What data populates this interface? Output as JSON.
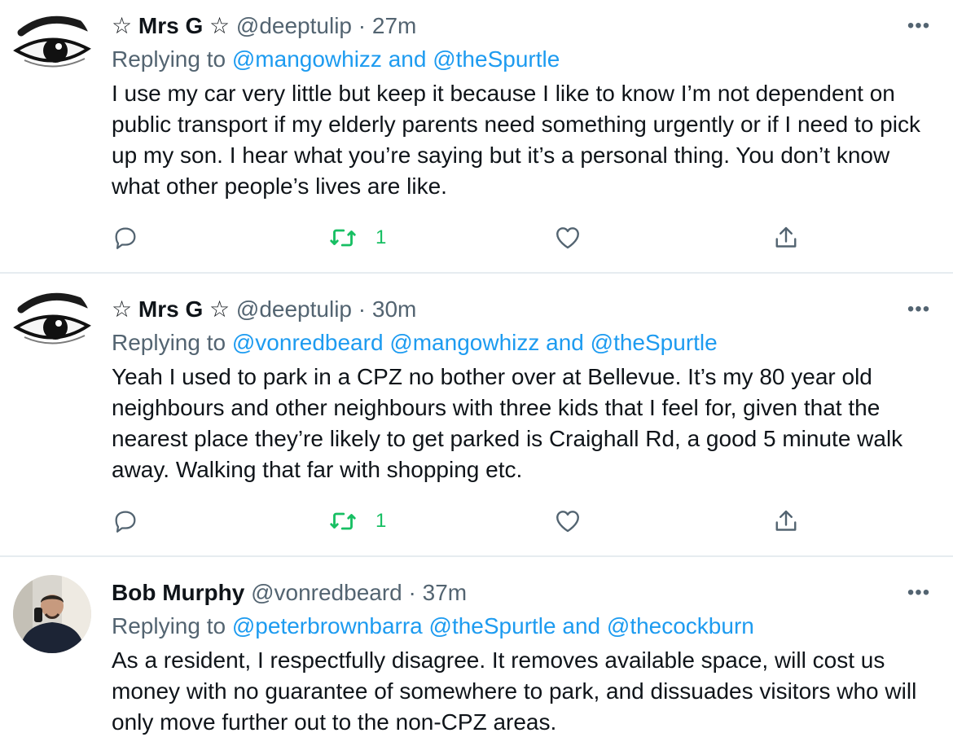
{
  "colors": {
    "link": "#1d9bf0",
    "secondary_text": "#536471",
    "retweet_active": "#17bf63",
    "divider": "#e6ecf0"
  },
  "icons": {
    "reply": "reply-icon",
    "retweet": "retweet-icon",
    "like": "heart-icon",
    "share": "share-icon",
    "more": "more-icon"
  },
  "tweets": [
    {
      "name": "☆ Mrs G ☆",
      "handle": "@deeptulip",
      "separator": "·",
      "time": "27m",
      "replying_prefix": "Replying to",
      "mention_1": "@mangowhizz",
      "mention_joiner": "and",
      "mention_2": "@theSpurtle",
      "text": "I use my car very little but keep it because I like to know I’m not dependent on public transport if my elderly parents need something urgently or if I need to pick up my son. I hear what you’re saying but it’s a personal thing. You don’t know what other people’s lives are like.",
      "retweets": "1"
    },
    {
      "name": "☆ Mrs G ☆",
      "handle": "@deeptulip",
      "separator": "·",
      "time": "30m",
      "replying_prefix": "Replying to",
      "mention_1": "@vonredbeard",
      "mention_2": "@mangowhizz",
      "mention_joiner": "and",
      "mention_3": "@theSpurtle",
      "text": "Yeah I used to park in a CPZ no bother over at Bellevue. It’s my 80 year old neighbours and other neighbours with three kids that I feel for, given that the nearest place they’re likely to get parked is Craighall Rd, a good 5 minute walk away. Walking that far with shopping etc.",
      "retweets": "1"
    },
    {
      "name": "Bob Murphy",
      "handle": "@vonredbeard",
      "separator": "·",
      "time": "37m",
      "replying_prefix": "Replying to",
      "mention_1": "@peterbrownbarra",
      "mention_2": "@theSpurtle",
      "mention_joiner": "and",
      "mention_3": "@thecockburn",
      "text": "As a resident, I respectfully disagree. It removes available space, will cost us money with no guarantee of somewhere to park, and dissuades visitors who will only move further out to the non-CPZ areas."
    }
  ]
}
